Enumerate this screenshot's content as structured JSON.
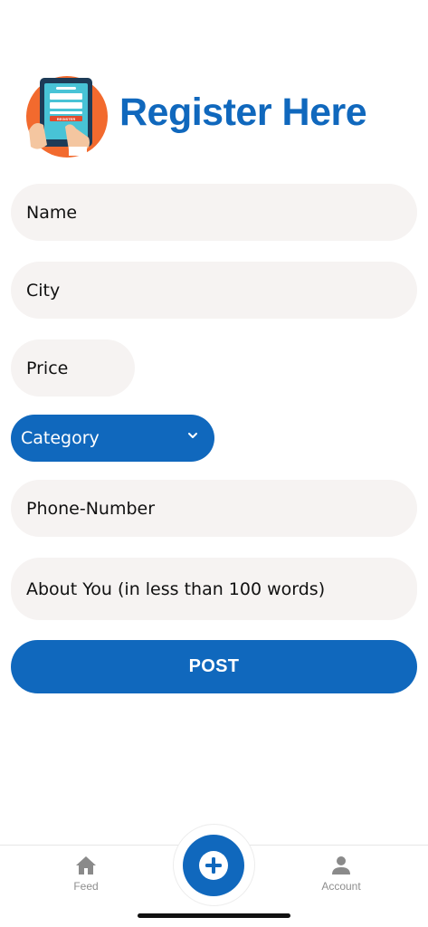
{
  "header": {
    "title": "Register Here",
    "logo_text": "REGISTER"
  },
  "form": {
    "name_placeholder": "Name",
    "city_placeholder": "City",
    "price_placeholder": "Price",
    "category_selected": "Category",
    "phone_placeholder": "Phone-Number",
    "about_placeholder": "About You (in less than 100 words)",
    "post_label": "POST"
  },
  "tabbar": {
    "feed_label": "Feed",
    "account_label": "Account",
    "add_icon": "plus-circle-icon"
  },
  "colors": {
    "accent": "#1068bd",
    "field_bg": "#f6f3f2",
    "logo_orange": "#f26a2e"
  }
}
